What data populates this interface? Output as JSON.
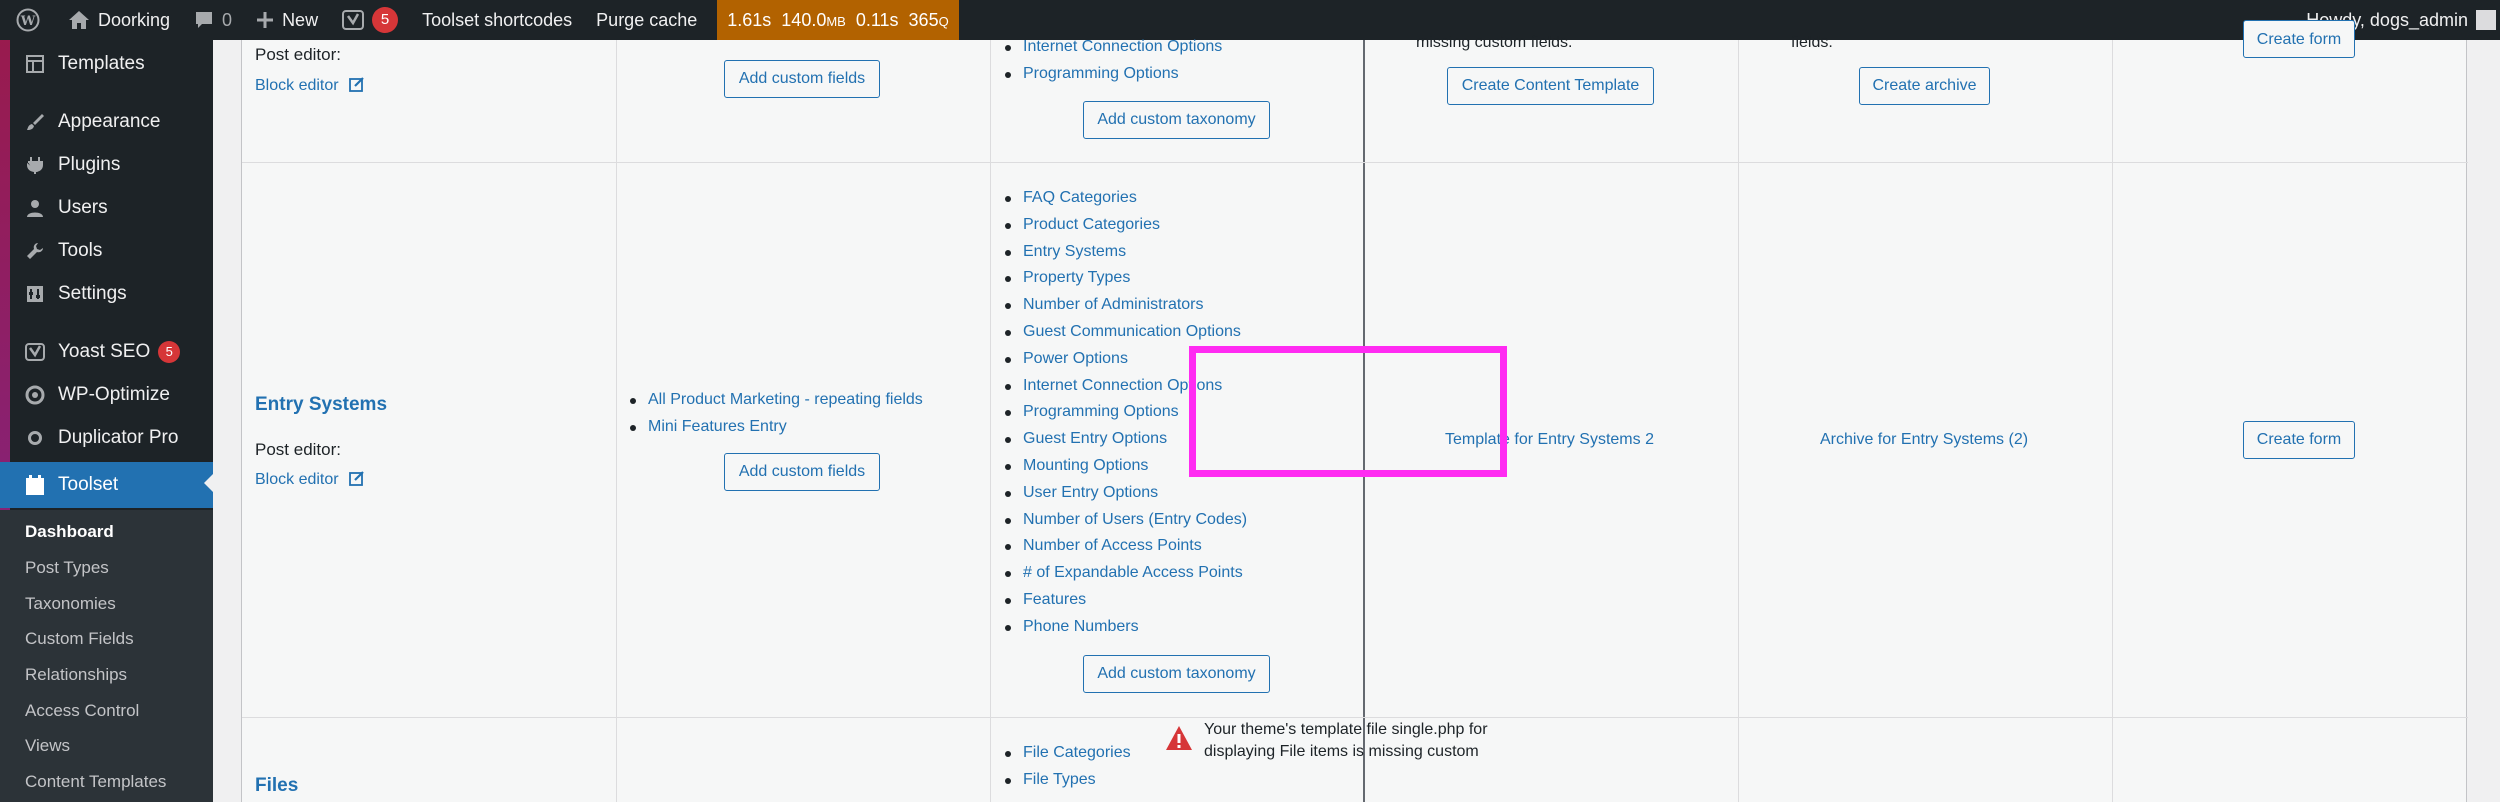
{
  "admin_bar": {
    "site_name": "Doorking",
    "comments_count": "0",
    "new_label": "New",
    "yoast_count": "5",
    "toolset_shortcodes": "Toolset shortcodes",
    "purge_cache": "Purge cache",
    "perf": {
      "time": "1.61s",
      "memory_value": "140.0",
      "memory_unit": "MB",
      "query_time": "0.11s",
      "queries_value": "365",
      "queries_unit": "Q"
    },
    "howdy": "Howdy, dogs_admin"
  },
  "sidebar": {
    "items": [
      {
        "label": "Templates",
        "icon": "templates-icon"
      },
      {
        "label": "Appearance",
        "icon": "paintbrush-icon"
      },
      {
        "label": "Plugins",
        "icon": "plugin-icon"
      },
      {
        "label": "Users",
        "icon": "users-icon"
      },
      {
        "label": "Tools",
        "icon": "wrench-icon"
      },
      {
        "label": "Settings",
        "icon": "settings-icon"
      },
      {
        "label": "Yoast SEO",
        "icon": "yoast-icon",
        "badge": "5"
      },
      {
        "label": "WP-Optimize",
        "icon": "wp-optimize-icon"
      },
      {
        "label": "Duplicator Pro",
        "icon": "duplicator-icon"
      },
      {
        "label": "Toolset",
        "icon": "toolset-icon"
      }
    ],
    "submenu": [
      "Dashboard",
      "Post Types",
      "Taxonomies",
      "Custom Fields",
      "Relationships",
      "Access Control",
      "Views",
      "Content Templates"
    ]
  },
  "top_row": {
    "post_editor_label": "Post editor:",
    "block_editor_link": "Block editor",
    "add_custom_fields": "Add custom fields",
    "taxonomies": [
      "Internet Connection Options",
      "Programming Options"
    ],
    "add_custom_taxonomy": "Add custom taxonomy",
    "template_note": "missing custom fields.",
    "create_content_template": "Create Content Template",
    "archive_note": "fields.",
    "create_archive": "Create archive",
    "create_form": "Create form"
  },
  "entry_row": {
    "title": "Entry Systems",
    "post_editor_label": "Post editor:",
    "block_editor_link": "Block editor",
    "field_groups": [
      "All Product Marketing - repeating fields",
      "Mini Features Entry"
    ],
    "add_custom_fields": "Add custom fields",
    "taxonomies": [
      "FAQ Categories",
      "Product Categories",
      "Entry Systems",
      "Property Types",
      "Number of Administrators",
      "Guest Communication Options",
      "Power Options",
      "Internet Connection Options",
      "Programming Options",
      "Guest Entry Options",
      "Mounting Options",
      "User Entry Options",
      "Number of Users (Entry Codes)",
      "Number of Access Points",
      "# of Expandable Access Points",
      "Features",
      "Phone Numbers"
    ],
    "add_custom_taxonomy": "Add custom taxonomy",
    "template_link": "Template for Entry Systems 2",
    "archive_link": "Archive for Entry Systems (2)",
    "create_form": "Create form"
  },
  "files_row": {
    "title": "Files",
    "taxonomies": [
      "File Categories",
      "File Types"
    ],
    "warning": "Your theme's template file single.php for displaying File items is missing custom"
  }
}
